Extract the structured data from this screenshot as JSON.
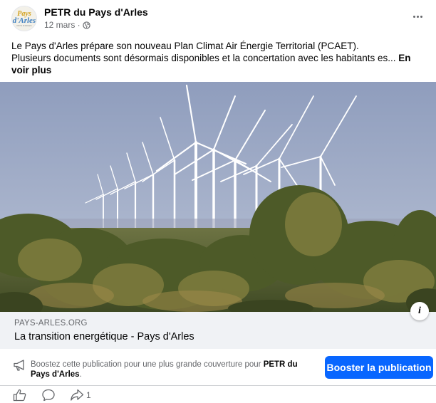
{
  "post": {
    "page_name": "PETR du Pays d'Arles",
    "date": "12 mars · ",
    "privacy_icon": "globe-icon",
    "text_line1": "Le Pays d'Arles prépare son nouveau Plan Climat Air Énergie Territorial (PCAET).",
    "text_line2": "Plusieurs documents sont désormais disponibles et la concertation avec les habitants es... ",
    "see_more": "En voir plus",
    "avatar": {
      "line1": "Pays",
      "line2": "d'Arles",
      "line3": "PAYS D'ARLES"
    }
  },
  "link_preview": {
    "domain": "PAYS-ARLES.ORG",
    "title": "La transition energétique - Pays d'Arles",
    "info_label": "i"
  },
  "boost": {
    "text_before": "Boostez cette publication pour une plus grande couverture pour ",
    "page_name": "PETR du Pays d'Arles",
    "text_after": ".",
    "button_label": "Booster la publication",
    "button_color": "#0866ff"
  },
  "actions": {
    "share_count": "1"
  }
}
